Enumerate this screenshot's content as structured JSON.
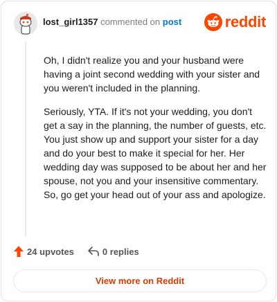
{
  "header": {
    "username": "lost_girl1357",
    "action_text": "commented on",
    "link_text": "post",
    "brand": "reddit"
  },
  "comment": {
    "paragraphs": [
      "Oh, I didn't realize you and your husband were having a joint second wedding with your sister and you weren't included in the planning.",
      "Seriously, YTA. If it's not your wedding, you don't get a say in the planning, the number of guests, etc. You just show up and support your sister for a day and do your best to make it special for her. Her wedding day was supposed to be about her and her spouse, not you and your insensitive commentary. So, go get your head out of your ass and apologize."
    ]
  },
  "actions": {
    "upvotes": "24 upvotes",
    "replies": "0 replies"
  },
  "footer": {
    "view_more": "View more on Reddit"
  },
  "colors": {
    "brand": "#ff4500",
    "link": "#0079d3",
    "view_more": "#d93a00"
  },
  "icons": [
    "avatar",
    "reddit-logo-icon",
    "upvote-arrow-icon",
    "reply-icon"
  ]
}
